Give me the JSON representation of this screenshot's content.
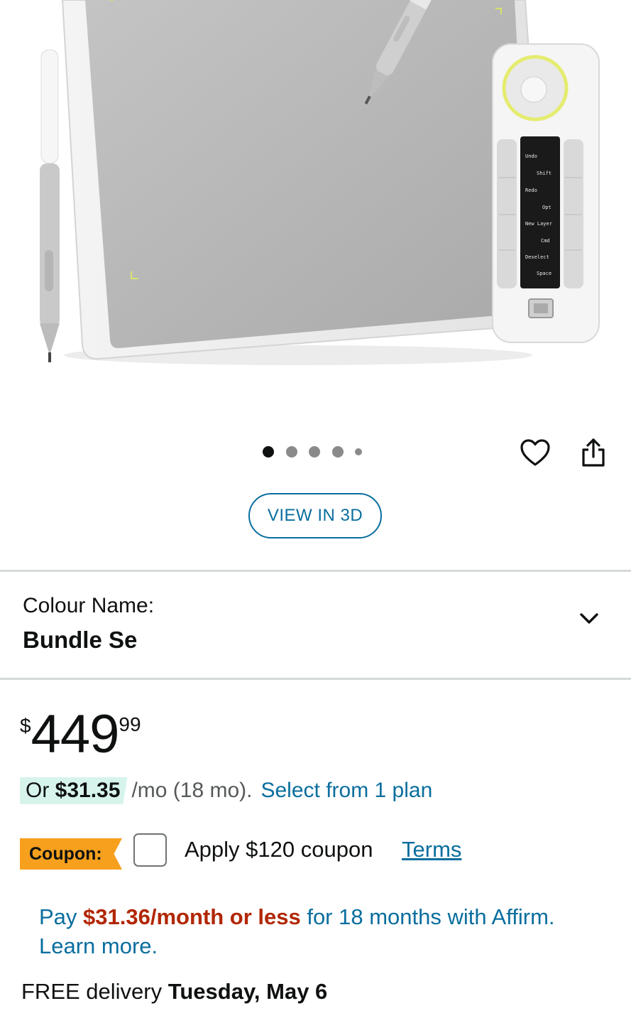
{
  "carousel": {
    "dot_count": 5,
    "active_index": 0
  },
  "product_image": {
    "keypad_labels": [
      "Undo",
      "Shift",
      "Redo",
      "Opt",
      "New Layer",
      "Cmd",
      "Deselect",
      "Space"
    ]
  },
  "actions": {
    "wishlist_icon": "heart-icon",
    "share_icon": "share-icon",
    "view_3d_label": "VIEW IN 3D"
  },
  "variant": {
    "label": "Colour Name:",
    "value": "Bundle Se"
  },
  "price": {
    "symbol": "$",
    "whole": "449",
    "fraction": "99"
  },
  "installment": {
    "prefix": "Or ",
    "amount": "$31.35",
    "period": "/mo (18 mo).",
    "link": "Select from 1 plan"
  },
  "coupon": {
    "badge": "Coupon:",
    "text": "Apply $120 coupon",
    "terms": "Terms",
    "checked": false
  },
  "affirm": {
    "before": "Pay ",
    "amount": "$31.36/month or less",
    "after": " for 18 months with Affirm. Learn more."
  },
  "delivery": {
    "prefix": "FREE delivery ",
    "date": "Tuesday, May 6"
  },
  "colors": {
    "link": "#0a6e9e",
    "price_red": "#b12704",
    "coupon_badge": "#f7a01d",
    "installment_highlight": "#d7f4ec"
  }
}
